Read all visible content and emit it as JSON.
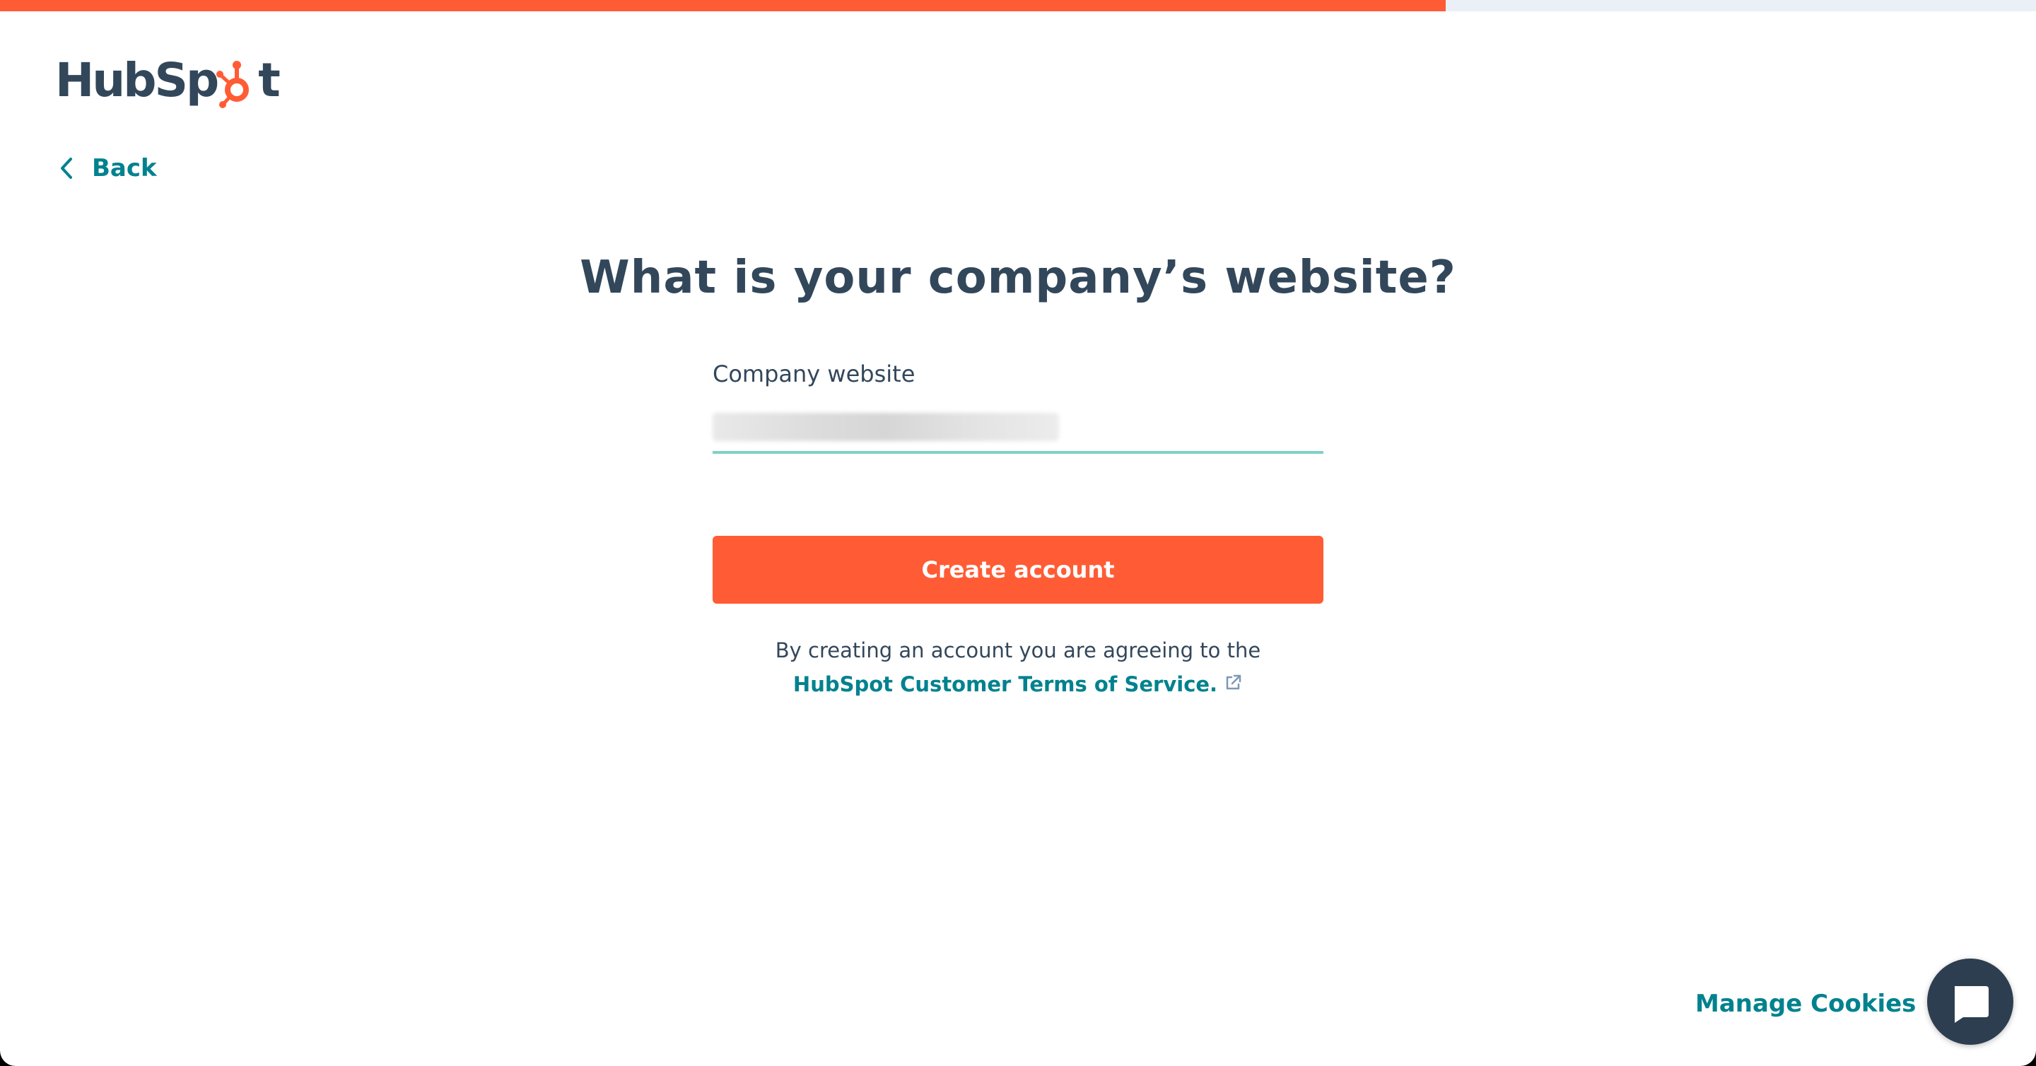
{
  "progress": {
    "percent": 71
  },
  "brand": {
    "logo_text_left": "HubSp",
    "logo_text_right": "t",
    "logo_alt": "HubSpot",
    "primary_color": "#ff5c35",
    "text_color": "#33475b",
    "link_color": "#00828e"
  },
  "nav": {
    "back_label": "Back"
  },
  "main": {
    "heading": "What is your company’s website?",
    "field": {
      "label": "Company website",
      "value": "",
      "value_is_redacted": true
    },
    "submit_label": "Create account",
    "terms": {
      "prefix": "By creating an account you are agreeing to the ",
      "link_text": "HubSpot Customer Terms of Service.",
      "link_icon": "external-link-icon"
    }
  },
  "footer": {
    "manage_cookies_label": "Manage Cookies",
    "chat_icon": "chat-bubble-icon"
  }
}
